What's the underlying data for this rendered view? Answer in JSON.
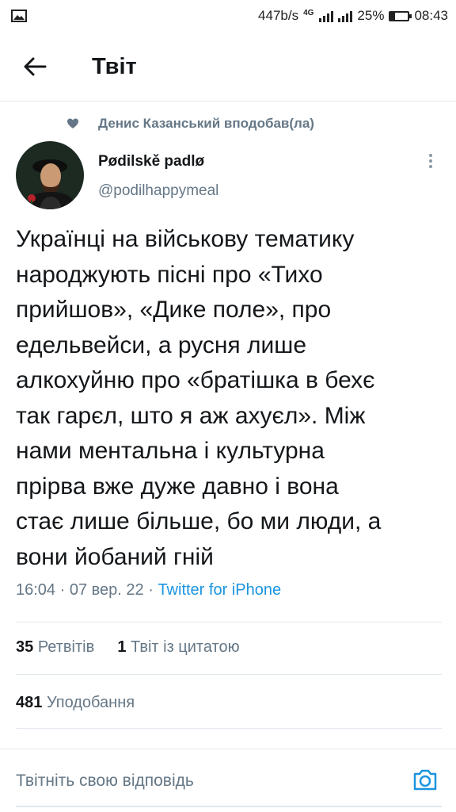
{
  "status_bar": {
    "speed": "447b/s",
    "network": "4G",
    "battery": "25%",
    "battery_level": 0.25,
    "time": "08:43"
  },
  "header": {
    "title": "Твіт"
  },
  "social_context": {
    "text": "Денис Казанський вподобав(ла)"
  },
  "author": {
    "name": "Pødilskě padlø",
    "handle": "@podilhappymeal"
  },
  "tweet": {
    "text": "Українці на військову тематику\nнароджують пісні про «Тихо\nприйшов», «Дике поле», про\nедельвейси, а русня лише\nалкохуйню про «братішка в бехє\nтак гарєл, што я аж ахуєл». Між\nнами ментальна і культурна\nпрірва вже дуже давно і вона\nстає лише більше, бо ми люди, а\nвони йобаний гній",
    "time": "16:04",
    "date": "07 вер. 22",
    "source": "Twitter for iPhone"
  },
  "stats": {
    "retweets_count": "35",
    "retweets_label": "Ретвітів",
    "quotes_count": "1",
    "quotes_label": "Твіт із цитатою",
    "likes_count": "481",
    "likes_label": "Уподобання"
  },
  "reply": {
    "placeholder": "Твітніть свою відповідь"
  },
  "colors": {
    "accent": "#1b95e0",
    "secondary_text": "#657786",
    "primary_text": "#14171a",
    "divider": "#e1e8ed"
  },
  "icons": {
    "back": "arrow-left-icon",
    "heart": "heart-icon",
    "more": "more-vertical-icon",
    "camera": "camera-icon"
  }
}
